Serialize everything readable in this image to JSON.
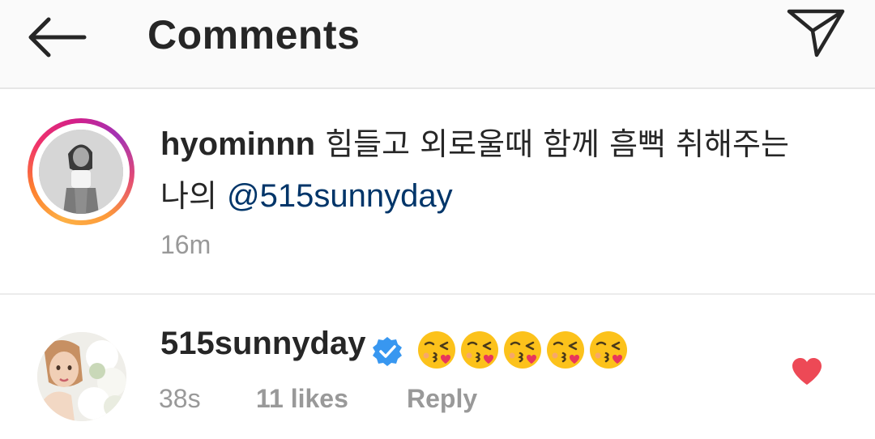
{
  "header": {
    "title": "Comments",
    "back_icon": "arrow-left-icon",
    "send_icon": "paper-plane-icon"
  },
  "caption": {
    "username": "hyominnn",
    "text": "힘들고 외로울때 함께 흠뻑 취해주는 나의",
    "mention": "@515sunnyday",
    "time": "16m"
  },
  "comment": {
    "username": "515sunnyday",
    "verified": true,
    "emoji": "😘😘😘😘😘",
    "time": "38s",
    "likes": "11 likes",
    "reply_label": "Reply",
    "liked": true
  },
  "colors": {
    "mention": "#003569",
    "meta_text": "#999999",
    "verified_badge": "#3897f0",
    "liked_heart": "#ed4956"
  }
}
